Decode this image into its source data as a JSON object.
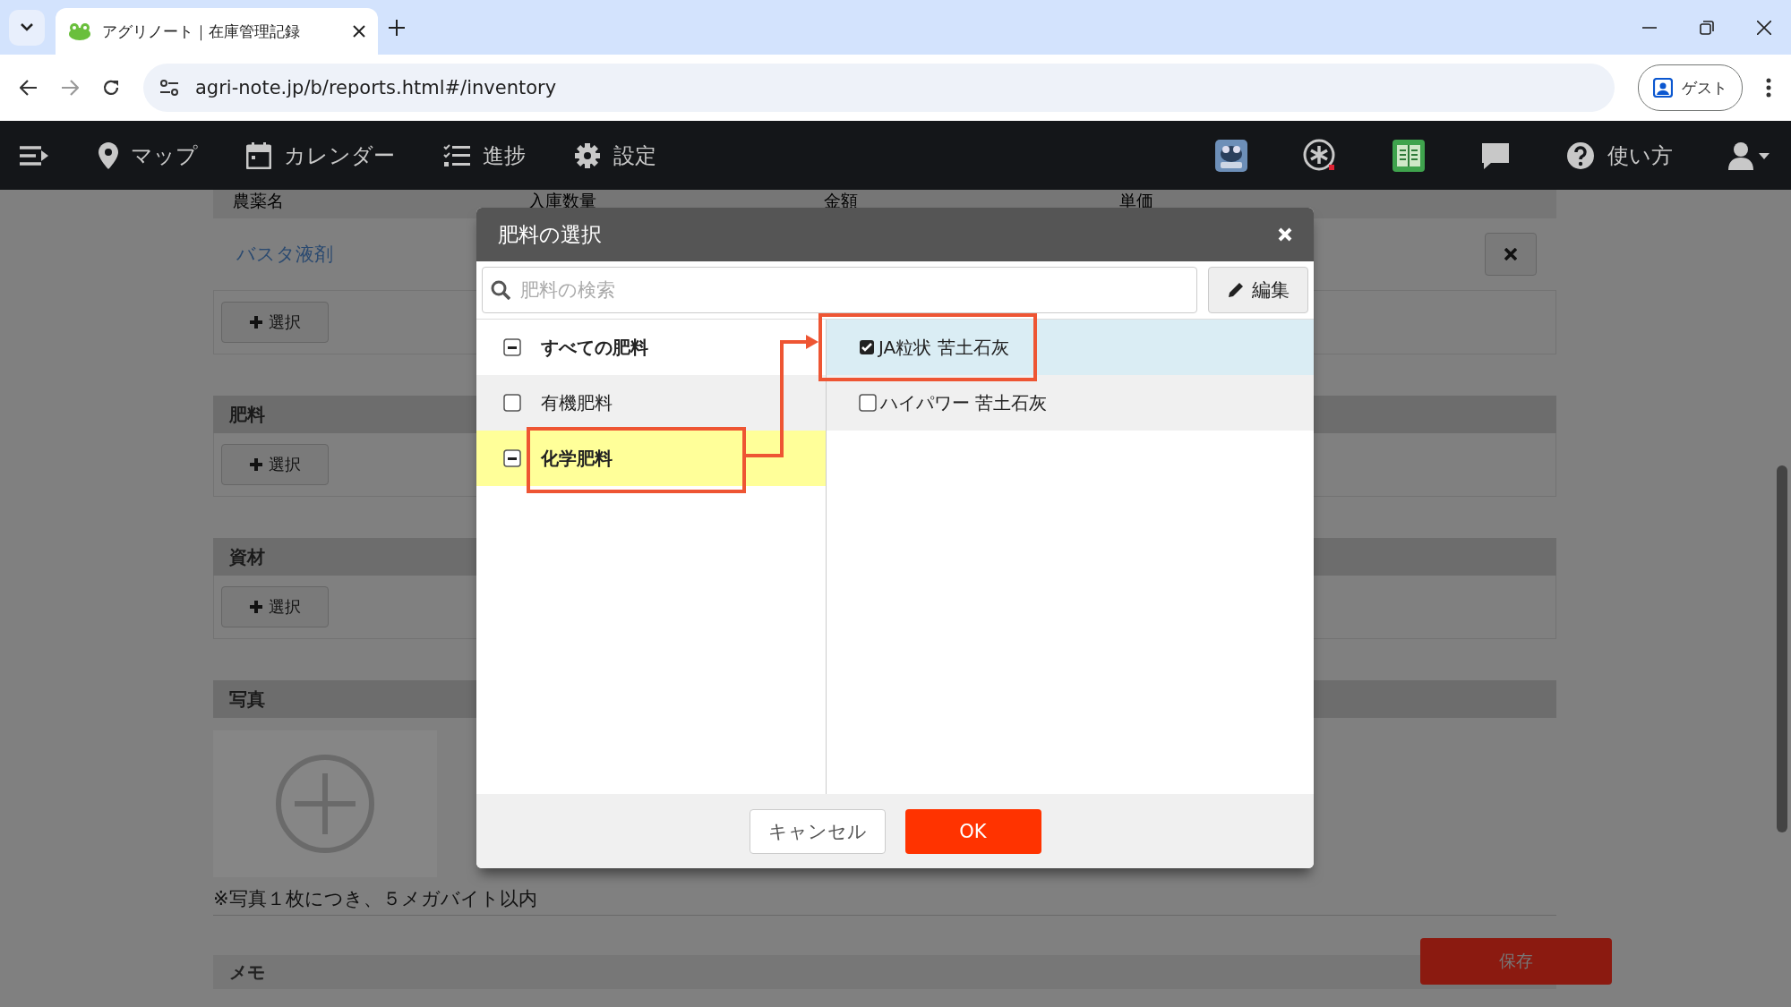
{
  "browser": {
    "tab_title": "アグリノート｜在庫管理記録",
    "url": "agri-note.jp/b/reports.html#/inventory",
    "profile": "ゲスト"
  },
  "nav": {
    "left": [
      {
        "kind": "map",
        "label": "マップ"
      },
      {
        "kind": "calendar",
        "label": "カレンダー"
      },
      {
        "kind": "progress",
        "label": "進捗"
      },
      {
        "kind": "settings",
        "label": "設定"
      }
    ],
    "right": [
      {
        "kind": "frog"
      },
      {
        "kind": "asterisk"
      },
      {
        "kind": "book"
      },
      {
        "kind": "chat"
      },
      {
        "kind": "help",
        "label": "使い方"
      },
      {
        "kind": "user"
      }
    ]
  },
  "page": {
    "table_columns": [
      "農薬名",
      "入庫数量",
      "金額",
      "単価"
    ],
    "pesticide_row": "バスタ液剤",
    "pesticide_select": "選択",
    "sections": [
      {
        "kind": "select",
        "title": "肥料",
        "button": "選択"
      },
      {
        "kind": "select",
        "title": "資材",
        "button": "選択"
      },
      {
        "kind": "photo",
        "title": "写真"
      }
    ],
    "photo_note": "※写真１枚につき、５メガバイト以内",
    "memo_label": "メモ",
    "save_button": "保存"
  },
  "dialog": {
    "title": "肥料の選択",
    "search": {
      "placeholder": "肥料の検索"
    },
    "edit_button": "編集",
    "categories": [
      {
        "label": "すべての肥料",
        "indeterminate": true,
        "selected": false
      },
      {
        "label": "有機肥料",
        "indeterminate": false,
        "selected": false
      },
      {
        "label": "化学肥料",
        "indeterminate": true,
        "selected": true
      }
    ],
    "fertilizers": [
      {
        "label": "JA粒状 苦土石灰",
        "checked": true
      },
      {
        "label": "ハイパワー 苦土石灰",
        "checked": false
      }
    ],
    "cancel_button": "キャンセル",
    "ok_button": "OK"
  }
}
